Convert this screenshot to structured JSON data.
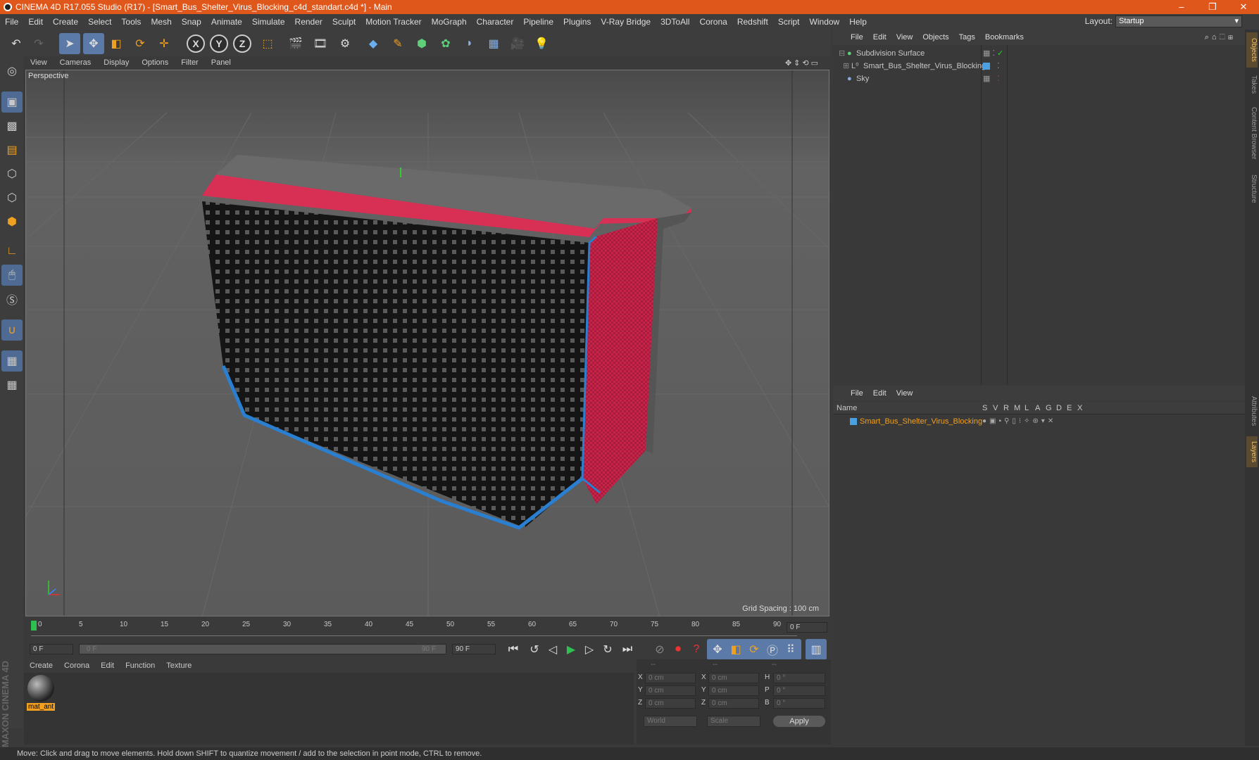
{
  "window": {
    "title": "CINEMA 4D R17.055 Studio (R17) - [Smart_Bus_Shelter_Virus_Blocking_c4d_standart.c4d *] - Main",
    "minimize": "–",
    "maximize": "❐",
    "close": "✕"
  },
  "menubar": {
    "items": [
      "File",
      "Edit",
      "Create",
      "Select",
      "Tools",
      "Mesh",
      "Snap",
      "Animate",
      "Simulate",
      "Render",
      "Sculpt",
      "Motion Tracker",
      "MoGraph",
      "Character",
      "Pipeline",
      "Plugins",
      "V-Ray Bridge",
      "3DToAll",
      "Corona",
      "Redshift",
      "Script",
      "Window",
      "Help"
    ],
    "layout_label": "Layout:",
    "layout_value": "Startup"
  },
  "toolbar": {
    "x_label": "X",
    "y_label": "Y",
    "z_label": "Z"
  },
  "viewport": {
    "menu": [
      "View",
      "Cameras",
      "Display",
      "Options",
      "Filter",
      "Panel"
    ],
    "camera_label": "Perspective",
    "grid_spacing": "Grid Spacing : 100 cm"
  },
  "timeline": {
    "ticks": [
      "0",
      "5",
      "10",
      "15",
      "20",
      "25",
      "30",
      "35",
      "40",
      "45",
      "50",
      "55",
      "60",
      "65",
      "70",
      "75",
      "80",
      "85",
      "90"
    ],
    "current_frame": "0 F",
    "start_field": "0 F",
    "range_start": "0 F",
    "range_end": "90 F",
    "end_field": "90 F"
  },
  "material_manager": {
    "menu": [
      "Create",
      "Corona",
      "Edit",
      "Function",
      "Texture"
    ],
    "material_name": "mat_ant",
    "brand": "MAXON CINEMA 4D"
  },
  "coordinates": {
    "headers": [
      "--",
      "--",
      "--"
    ],
    "rows": [
      {
        "axis1": "X",
        "pos": "0 cm",
        "axis2": "X",
        "size": "0 cm",
        "axis3": "H",
        "rot": "0 °"
      },
      {
        "axis1": "Y",
        "pos": "0 cm",
        "axis2": "Y",
        "size": "0 cm",
        "axis3": "P",
        "rot": "0 °"
      },
      {
        "axis1": "Z",
        "pos": "0 cm",
        "axis2": "Z",
        "size": "0 cm",
        "axis3": "B",
        "rot": "0 °"
      }
    ],
    "mode1": "World",
    "mode2": "Scale",
    "apply": "Apply"
  },
  "object_manager": {
    "menu": [
      "File",
      "Edit",
      "View",
      "Objects",
      "Tags",
      "Bookmarks"
    ],
    "objects": [
      {
        "name": "Subdivision Surface",
        "indent": 0
      },
      {
        "name": "Smart_Bus_Shelter_Virus_Blocking",
        "indent": 1
      },
      {
        "name": "Sky",
        "indent": 0
      }
    ]
  },
  "layer_manager": {
    "menu": [
      "File",
      "Edit",
      "View"
    ],
    "col_name": "Name",
    "col_flags": [
      "S",
      "V",
      "R",
      "M",
      "L",
      "A",
      "G",
      "D",
      "E",
      "X"
    ],
    "layer_name": "Smart_Bus_Shelter_Virus_Blocking"
  },
  "side_tabs": [
    "Objects",
    "Takes",
    "Content Browser",
    "Structure",
    "Attributes",
    "Layers"
  ],
  "status": "Move: Click and drag to move elements. Hold down SHIFT to quantize movement / add to the selection in point mode, CTRL to remove.",
  "colors": {
    "accent": "#e0571b",
    "highlight": "#f0a020",
    "tool_active": "#5c7aa8",
    "shelter_red": "#c8234a",
    "shelter_blue": "#2a7fd0"
  }
}
